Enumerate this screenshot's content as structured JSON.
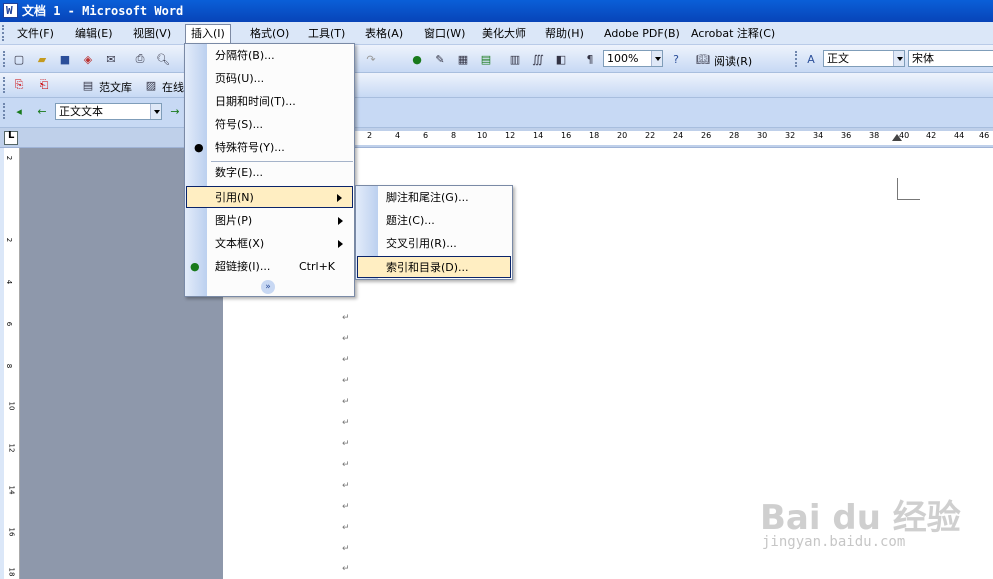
{
  "window": {
    "title": "文档 1 - Microsoft Word"
  },
  "menubar": [
    {
      "label": "文件(F)"
    },
    {
      "label": "编辑(E)"
    },
    {
      "label": "视图(V)"
    },
    {
      "label": "插入(I)"
    },
    {
      "label": "格式(O)"
    },
    {
      "label": "工具(T)"
    },
    {
      "label": "表格(A)"
    },
    {
      "label": "窗口(W)"
    },
    {
      "label": "美化大师"
    },
    {
      "label": "帮助(H)"
    },
    {
      "label": "Adobe PDF(B)"
    },
    {
      "label": "Acrobat 注释(C)"
    }
  ],
  "toolbar": {
    "zoom": "100%",
    "read_label": "阅读(R)",
    "style": "正文",
    "font": "宋体",
    "templates_label": "范文库",
    "online_label": "在线",
    "nav_style": "正文文本"
  },
  "ruler": {
    "ticks": [
      "2",
      "4",
      "6",
      "8",
      "10",
      "12",
      "14",
      "16",
      "18",
      "20",
      "22",
      "24",
      "26",
      "28",
      "30",
      "32",
      "34",
      "36",
      "38",
      "40",
      "42",
      "44",
      "46"
    ]
  },
  "vruler": {
    "ticks": [
      "2",
      "2",
      "4",
      "6",
      "8",
      "10",
      "12",
      "14",
      "16",
      "18"
    ]
  },
  "insert_menu": {
    "items": [
      {
        "label": "分隔符(B)..."
      },
      {
        "label": "页码(U)..."
      },
      {
        "label": "日期和时间(T)..."
      },
      {
        "label": "符号(S)..."
      },
      {
        "label": "特殊符号(Y)..."
      },
      {
        "label": "数字(E)..."
      },
      {
        "label": "引用(N)"
      },
      {
        "label": "图片(P)"
      },
      {
        "label": "文本框(X)"
      },
      {
        "label": "超链接(I)...",
        "shortcut": "Ctrl+K"
      }
    ],
    "expand_icon": "chevron-double-down-icon"
  },
  "reference_submenu": {
    "items": [
      {
        "label": "脚注和尾注(G)..."
      },
      {
        "label": "题注(C)..."
      },
      {
        "label": "交叉引用(R)..."
      },
      {
        "label": "索引和目录(D)..."
      }
    ]
  },
  "paragraph_mark": "↵",
  "watermark": {
    "brand": "Bai du 经验",
    "url": "jingyan.baidu.com"
  },
  "colors": {
    "title_bar": "#0a5fd8",
    "menu_highlight": "#ffeec2",
    "highlight_border": "#0a246a",
    "workspace_gray": "#8e98ab"
  }
}
